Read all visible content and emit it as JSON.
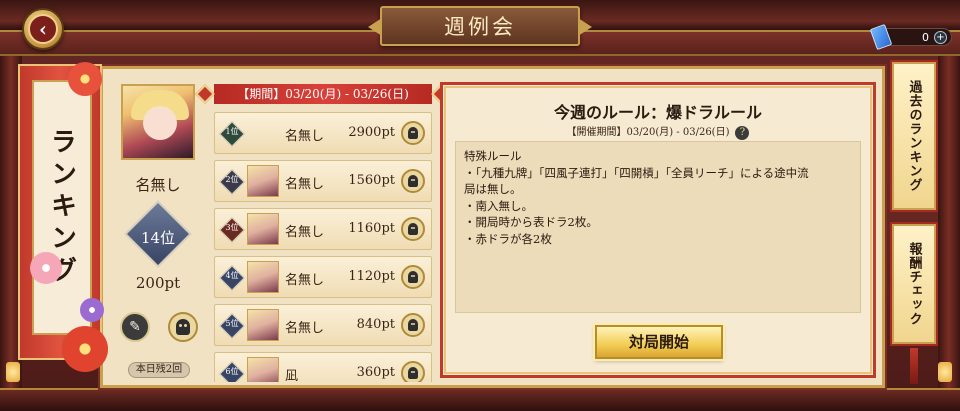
{
  "header": {
    "title": "週例会",
    "currency_value": "0",
    "plus_label": "+"
  },
  "left_banner": {
    "label": "ランキング"
  },
  "profile": {
    "name": "名無し",
    "rank": "14位",
    "points": "200pt",
    "today_label": "本日残2回"
  },
  "period": {
    "label": "【期間】03/20(月) - 03/26(日)"
  },
  "ranking": [
    {
      "rank": "1位",
      "name": "名無し",
      "points": "2900pt",
      "badge_color": "#2e4a3a",
      "has_avatar": false
    },
    {
      "rank": "2位",
      "name": "名無し",
      "points": "1560pt",
      "badge_color": "#3a3a4a",
      "has_avatar": true
    },
    {
      "rank": "3位",
      "name": "名無し",
      "points": "1160pt",
      "badge_color": "#6a2a20",
      "has_avatar": true
    },
    {
      "rank": "4位",
      "name": "名無し",
      "points": "1120pt",
      "badge_color": "#384463",
      "has_avatar": true
    },
    {
      "rank": "5位",
      "name": "名無し",
      "points": "840pt",
      "badge_color": "#384463",
      "has_avatar": true
    },
    {
      "rank": "6位",
      "name": "凪",
      "points": "360pt",
      "badge_color": "#384463",
      "has_avatar": true
    }
  ],
  "rule": {
    "title": "今週のルール：爆ドラルール",
    "period": "【開催期間】03/20(月) - 03/26(日)",
    "help_label": "?",
    "lines": [
      "特殊ルール",
      "・「九種九牌」「四風子連打」「四開槓」「全員リーチ」による途中流",
      "局は無し。",
      "・南入無し。",
      "・開局時から表ドラ2枚。",
      "・赤ドラが各2枚"
    ],
    "start_button": "対局開始"
  },
  "side_tabs": {
    "past_ranking": "過去のランキング",
    "reward_check": "報酬チェック"
  },
  "colors": {
    "accent_red": "#c0392b",
    "gold": "#c9a050",
    "parchment": "#f1e2c4"
  }
}
